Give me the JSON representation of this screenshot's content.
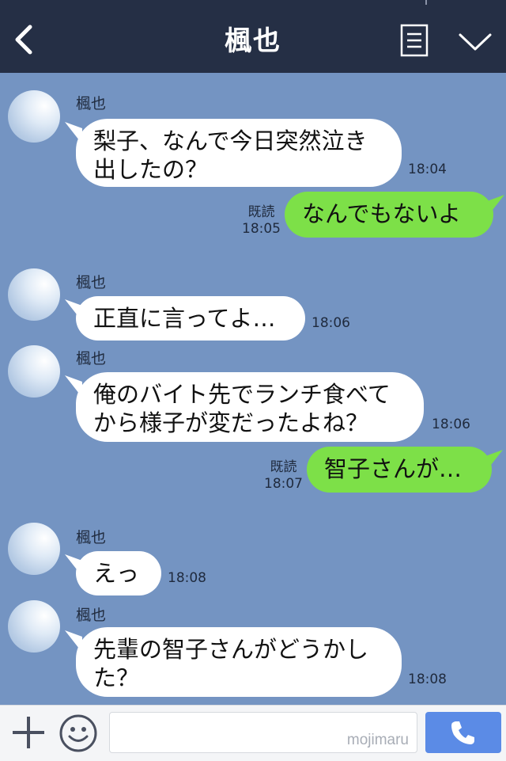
{
  "header": {
    "title": "楓也"
  },
  "messages": [
    {
      "type": "in",
      "sender": "楓也",
      "text": "梨子、なんで今日突然泣き\n出したの？",
      "time": "18:04"
    },
    {
      "type": "out",
      "read": "既読",
      "text": "なんでもないよ",
      "time": "18:05"
    },
    {
      "type": "in",
      "sender": "楓也",
      "text": "正直に言ってよ…",
      "time": "18:06"
    },
    {
      "type": "in",
      "sender": "楓也",
      "text": "俺のバイト先でランチ食べて\nから様子が変だったよね？",
      "time": "18:06"
    },
    {
      "type": "out",
      "read": "既読",
      "text": "智子さんが…",
      "time": "18:07"
    },
    {
      "type": "in",
      "sender": "楓也",
      "text": "えっ",
      "time": "18:08"
    },
    {
      "type": "in",
      "sender": "楓也",
      "text": "先輩の智子さんがどうかし\nた？",
      "time": "18:08"
    }
  ],
  "footer": {
    "input_value": "",
    "watermark": "mojimaru"
  },
  "icons": {
    "back": "chevron-left-icon",
    "menu": "menu-icon",
    "collapse": "chevron-down-icon",
    "plus": "plus-icon",
    "sticker": "smile-icon",
    "call": "phone-icon"
  },
  "colors": {
    "header_bg": "#252f45",
    "chat_bg": "#7494c2",
    "incoming_bubble": "#ffffff",
    "outgoing_bubble": "#7de048",
    "call_button": "#5b8be6"
  }
}
